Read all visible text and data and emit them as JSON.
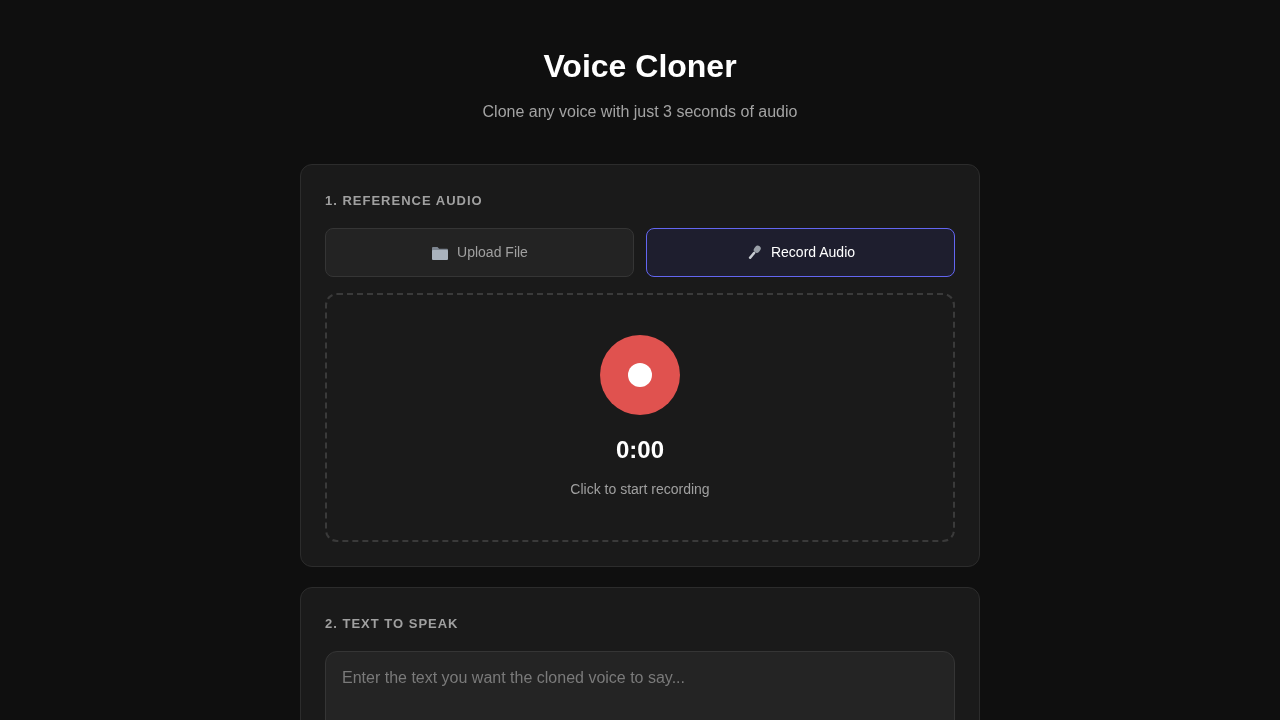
{
  "header": {
    "title": "Voice Cloner",
    "subtitle": "Clone any voice with just 3 seconds of audio"
  },
  "sections": [
    {
      "kind": "reference_audio",
      "heading": "1. REFERENCE AUDIO",
      "tabs": [
        {
          "kind": "upload",
          "label": "Upload File",
          "selected": false
        },
        {
          "kind": "record",
          "label": "Record Audio",
          "selected": true
        }
      ],
      "recorder": {
        "time": "0:00",
        "hint": "Click to start recording"
      }
    },
    {
      "kind": "text_input",
      "heading": "2. TEXT TO SPEAK",
      "text_field": {
        "placeholder": "Enter the text you want the cloned voice to say..."
      }
    }
  ]
}
